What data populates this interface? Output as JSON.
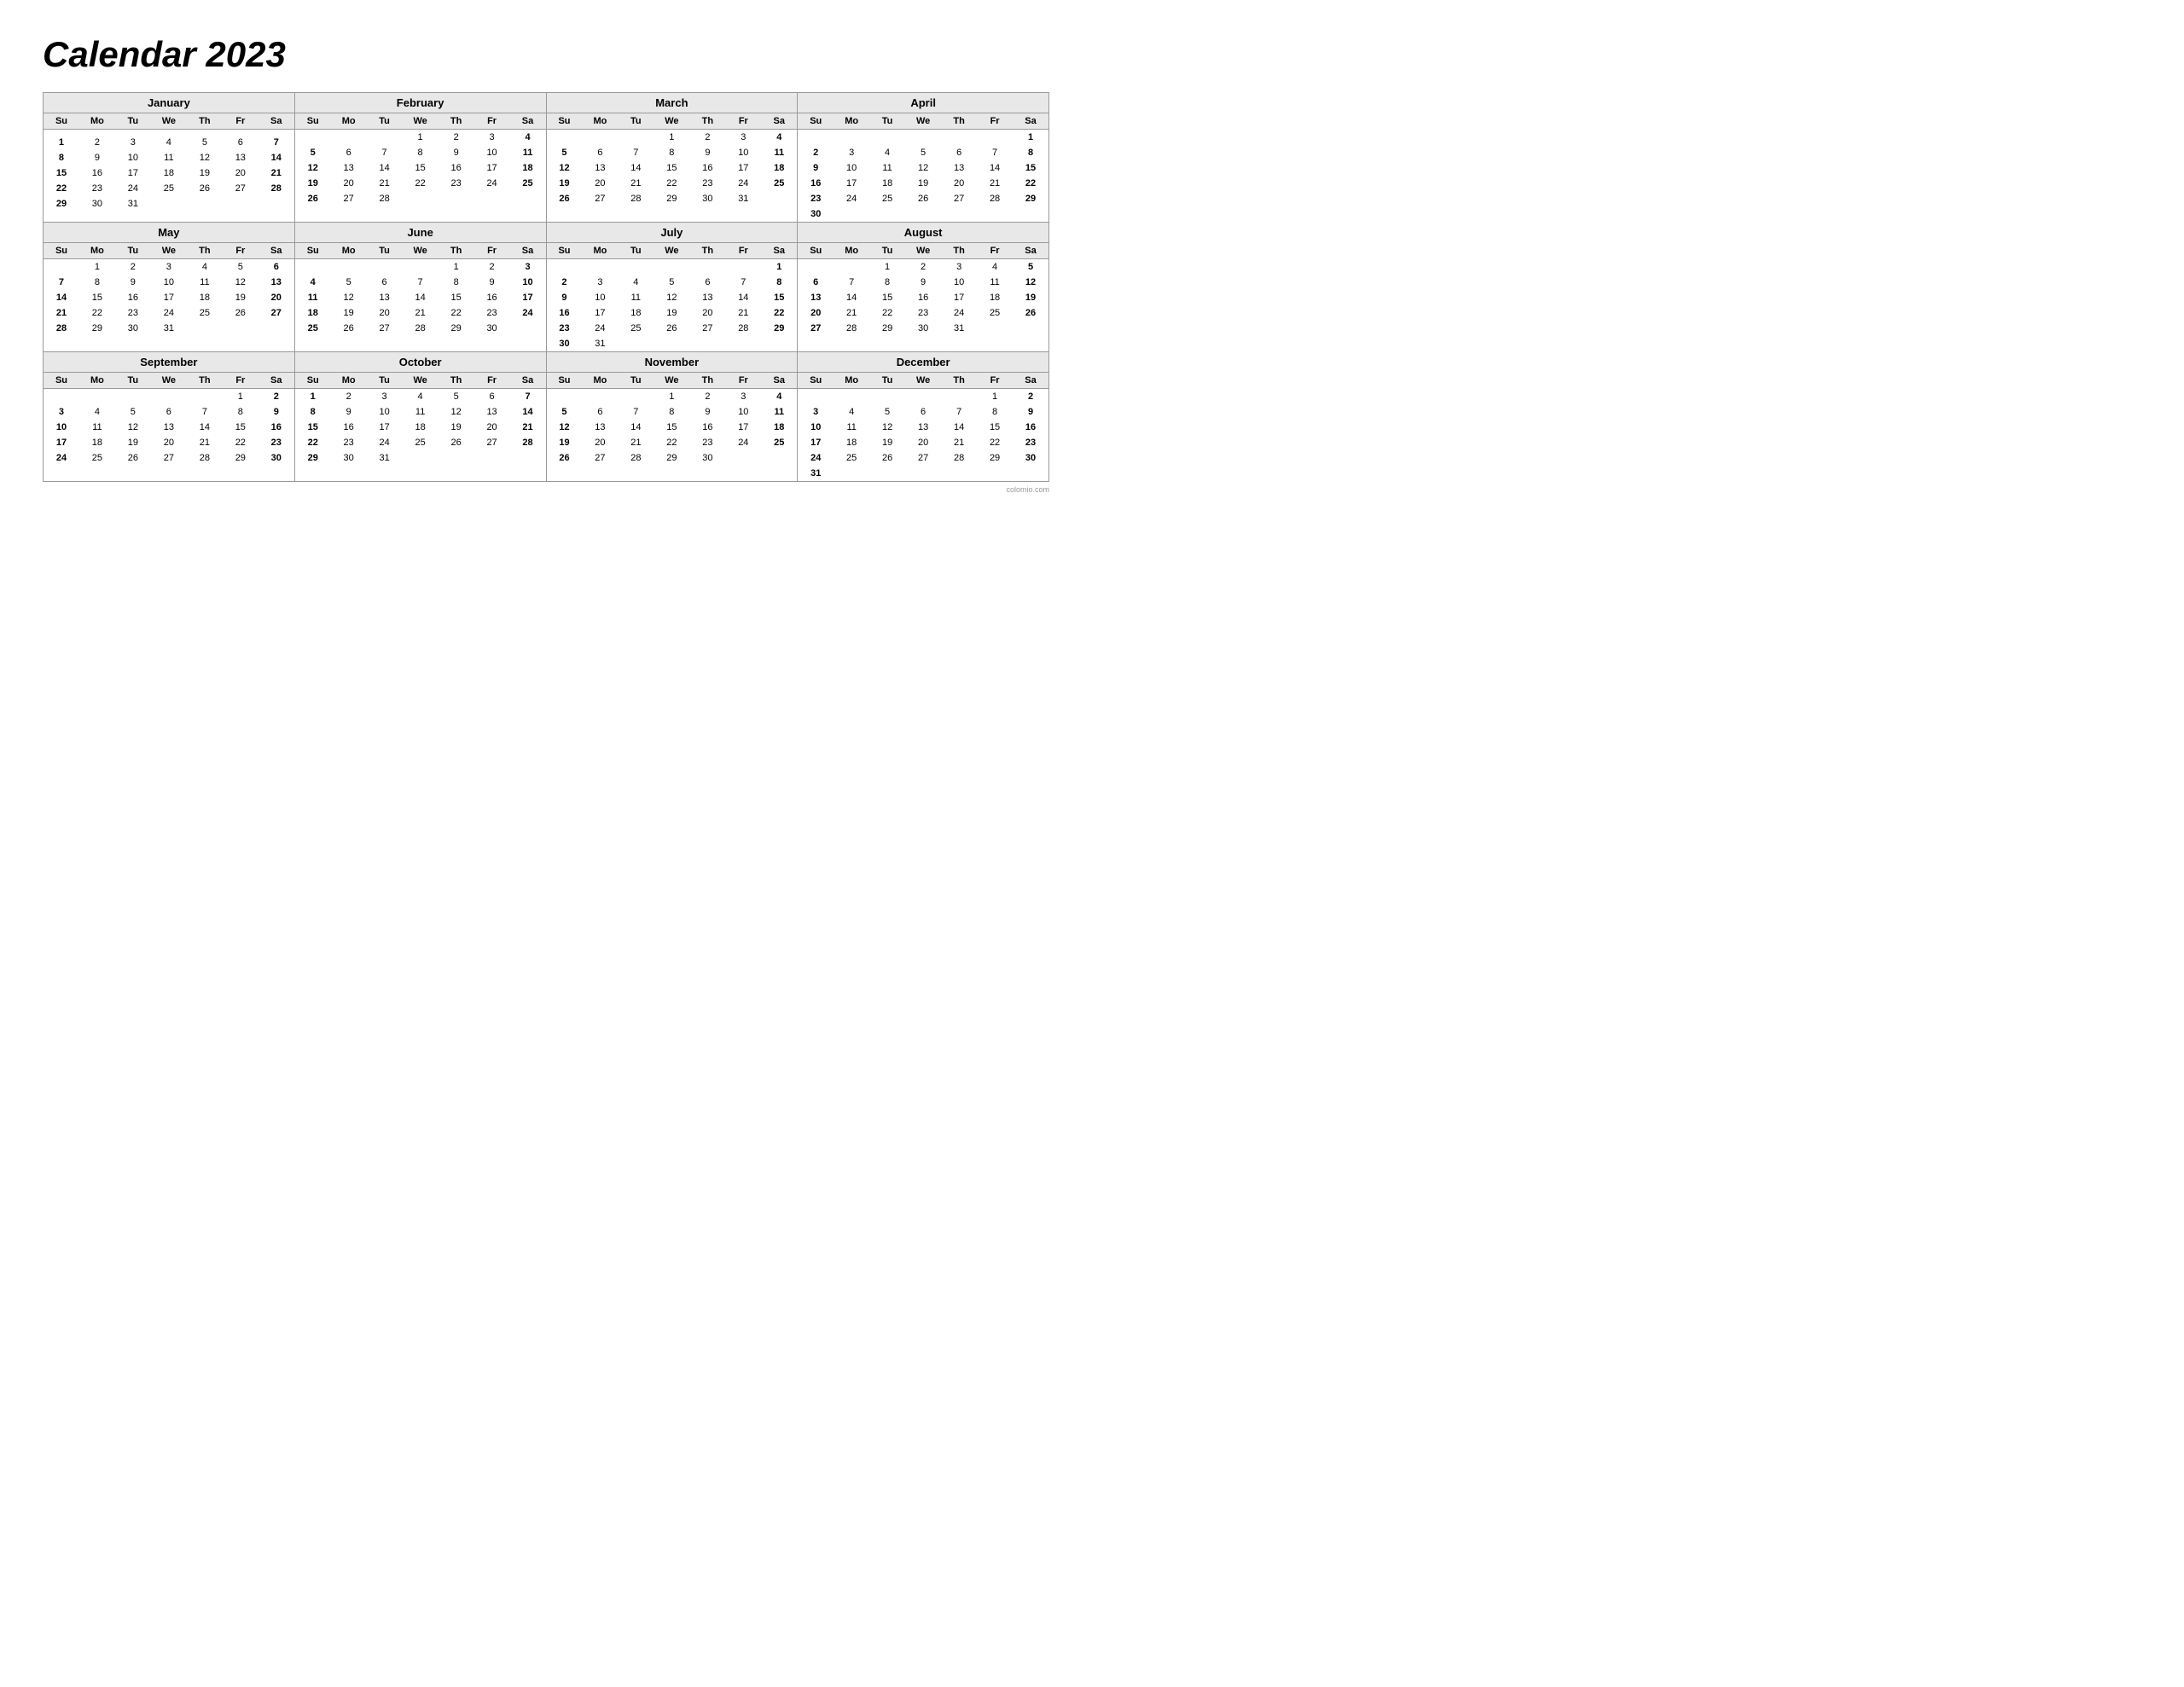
{
  "title": "Calendar 2023",
  "months": [
    {
      "name": "January",
      "days_header": [
        "Su",
        "Mo",
        "Tu",
        "We",
        "Th",
        "Fr",
        "Sa"
      ],
      "weeks": [
        [
          "",
          "",
          "",
          "",
          "",
          "",
          ""
        ],
        [
          "1",
          "2",
          "3",
          "4",
          "5",
          "6",
          "7"
        ],
        [
          "8",
          "9",
          "10",
          "11",
          "12",
          "13",
          "14"
        ],
        [
          "15",
          "16",
          "17",
          "18",
          "19",
          "20",
          "21"
        ],
        [
          "22",
          "23",
          "24",
          "25",
          "26",
          "27",
          "28"
        ],
        [
          "29",
          "30",
          "31",
          "",
          "",
          "",
          ""
        ]
      ]
    },
    {
      "name": "February",
      "days_header": [
        "Su",
        "Mo",
        "Tu",
        "We",
        "Th",
        "Fr",
        "Sa"
      ],
      "weeks": [
        [
          "",
          "",
          "",
          "1",
          "2",
          "3",
          "4"
        ],
        [
          "5",
          "6",
          "7",
          "8",
          "9",
          "10",
          "11"
        ],
        [
          "12",
          "13",
          "14",
          "15",
          "16",
          "17",
          "18"
        ],
        [
          "19",
          "20",
          "21",
          "22",
          "23",
          "24",
          "25"
        ],
        [
          "26",
          "27",
          "28",
          "",
          "",
          "",
          ""
        ],
        [
          "",
          "",
          "",
          "",
          "",
          "",
          ""
        ]
      ]
    },
    {
      "name": "March",
      "days_header": [
        "Su",
        "Mo",
        "Tu",
        "We",
        "Th",
        "Fr",
        "Sa"
      ],
      "weeks": [
        [
          "",
          "",
          "",
          "1",
          "2",
          "3",
          "4"
        ],
        [
          "5",
          "6",
          "7",
          "8",
          "9",
          "10",
          "11"
        ],
        [
          "12",
          "13",
          "14",
          "15",
          "16",
          "17",
          "18"
        ],
        [
          "19",
          "20",
          "21",
          "22",
          "23",
          "24",
          "25"
        ],
        [
          "26",
          "27",
          "28",
          "29",
          "30",
          "31",
          ""
        ],
        [
          "",
          "",
          "",
          "",
          "",
          "",
          ""
        ]
      ]
    },
    {
      "name": "April",
      "days_header": [
        "Su",
        "Mo",
        "Tu",
        "We",
        "Th",
        "Fr",
        "Sa"
      ],
      "weeks": [
        [
          "",
          "",
          "",
          "",
          "",
          "",
          "1"
        ],
        [
          "2",
          "3",
          "4",
          "5",
          "6",
          "7",
          "8"
        ],
        [
          "9",
          "10",
          "11",
          "12",
          "13",
          "14",
          "15"
        ],
        [
          "16",
          "17",
          "18",
          "19",
          "20",
          "21",
          "22"
        ],
        [
          "23",
          "24",
          "25",
          "26",
          "27",
          "28",
          "29"
        ],
        [
          "30",
          "",
          "",
          "",
          "",
          "",
          ""
        ]
      ]
    },
    {
      "name": "May",
      "days_header": [
        "Su",
        "Mo",
        "Tu",
        "We",
        "Th",
        "Fr",
        "Sa"
      ],
      "weeks": [
        [
          "",
          "1",
          "2",
          "3",
          "4",
          "5",
          "6"
        ],
        [
          "7",
          "8",
          "9",
          "10",
          "11",
          "12",
          "13"
        ],
        [
          "14",
          "15",
          "16",
          "17",
          "18",
          "19",
          "20"
        ],
        [
          "21",
          "22",
          "23",
          "24",
          "25",
          "26",
          "27"
        ],
        [
          "28",
          "29",
          "30",
          "31",
          "",
          "",
          ""
        ],
        [
          "",
          "",
          "",
          "",
          "",
          "",
          ""
        ]
      ]
    },
    {
      "name": "June",
      "days_header": [
        "Su",
        "Mo",
        "Tu",
        "We",
        "Th",
        "Fr",
        "Sa"
      ],
      "weeks": [
        [
          "",
          "",
          "",
          "",
          "1",
          "2",
          "3"
        ],
        [
          "4",
          "5",
          "6",
          "7",
          "8",
          "9",
          "10"
        ],
        [
          "11",
          "12",
          "13",
          "14",
          "15",
          "16",
          "17"
        ],
        [
          "18",
          "19",
          "20",
          "21",
          "22",
          "23",
          "24"
        ],
        [
          "25",
          "26",
          "27",
          "28",
          "29",
          "30",
          ""
        ],
        [
          "",
          "",
          "",
          "",
          "",
          "",
          ""
        ]
      ]
    },
    {
      "name": "July",
      "days_header": [
        "Su",
        "Mo",
        "Tu",
        "We",
        "Th",
        "Fr",
        "Sa"
      ],
      "weeks": [
        [
          "",
          "",
          "",
          "",
          "",
          "",
          "1"
        ],
        [
          "2",
          "3",
          "4",
          "5",
          "6",
          "7",
          "8"
        ],
        [
          "9",
          "10",
          "11",
          "12",
          "13",
          "14",
          "15"
        ],
        [
          "16",
          "17",
          "18",
          "19",
          "20",
          "21",
          "22"
        ],
        [
          "23",
          "24",
          "25",
          "26",
          "27",
          "28",
          "29"
        ],
        [
          "30",
          "31",
          "",
          "",
          "",
          "",
          ""
        ]
      ]
    },
    {
      "name": "August",
      "days_header": [
        "Su",
        "Mo",
        "Tu",
        "We",
        "Th",
        "Fr",
        "Sa"
      ],
      "weeks": [
        [
          "",
          "",
          "1",
          "2",
          "3",
          "4",
          "5"
        ],
        [
          "6",
          "7",
          "8",
          "9",
          "10",
          "11",
          "12"
        ],
        [
          "13",
          "14",
          "15",
          "16",
          "17",
          "18",
          "19"
        ],
        [
          "20",
          "21",
          "22",
          "23",
          "24",
          "25",
          "26"
        ],
        [
          "27",
          "28",
          "29",
          "30",
          "31",
          "",
          ""
        ],
        [
          "",
          "",
          "",
          "",
          "",
          "",
          ""
        ]
      ]
    },
    {
      "name": "September",
      "days_header": [
        "Su",
        "Mo",
        "Tu",
        "We",
        "Th",
        "Fr",
        "Sa"
      ],
      "weeks": [
        [
          "",
          "",
          "",
          "",
          "",
          "1",
          "2"
        ],
        [
          "3",
          "4",
          "5",
          "6",
          "7",
          "8",
          "9"
        ],
        [
          "10",
          "11",
          "12",
          "13",
          "14",
          "15",
          "16"
        ],
        [
          "17",
          "18",
          "19",
          "20",
          "21",
          "22",
          "23"
        ],
        [
          "24",
          "25",
          "26",
          "27",
          "28",
          "29",
          "30"
        ],
        [
          "",
          "",
          "",
          "",
          "",
          "",
          ""
        ]
      ]
    },
    {
      "name": "October",
      "days_header": [
        "Su",
        "Mo",
        "Tu",
        "We",
        "Th",
        "Fr",
        "Sa"
      ],
      "weeks": [
        [
          "1",
          "2",
          "3",
          "4",
          "5",
          "6",
          "7"
        ],
        [
          "8",
          "9",
          "10",
          "11",
          "12",
          "13",
          "14"
        ],
        [
          "15",
          "16",
          "17",
          "18",
          "19",
          "20",
          "21"
        ],
        [
          "22",
          "23",
          "24",
          "25",
          "26",
          "27",
          "28"
        ],
        [
          "29",
          "30",
          "31",
          "",
          "",
          "",
          ""
        ],
        [
          "",
          "",
          "",
          "",
          "",
          "",
          ""
        ]
      ]
    },
    {
      "name": "November",
      "days_header": [
        "Su",
        "Mo",
        "Tu",
        "We",
        "Th",
        "Fr",
        "Sa"
      ],
      "weeks": [
        [
          "",
          "",
          "",
          "1",
          "2",
          "3",
          "4"
        ],
        [
          "5",
          "6",
          "7",
          "8",
          "9",
          "10",
          "11"
        ],
        [
          "12",
          "13",
          "14",
          "15",
          "16",
          "17",
          "18"
        ],
        [
          "19",
          "20",
          "21",
          "22",
          "23",
          "24",
          "25"
        ],
        [
          "26",
          "27",
          "28",
          "29",
          "30",
          "",
          ""
        ],
        [
          "",
          "",
          "",
          "",
          "",
          "",
          ""
        ]
      ]
    },
    {
      "name": "December",
      "days_header": [
        "Su",
        "Mo",
        "Tu",
        "We",
        "Th",
        "Fr",
        "Sa"
      ],
      "weeks": [
        [
          "",
          "",
          "",
          "",
          "",
          "1",
          "2"
        ],
        [
          "3",
          "4",
          "5",
          "6",
          "7",
          "8",
          "9"
        ],
        [
          "10",
          "11",
          "12",
          "13",
          "14",
          "15",
          "16"
        ],
        [
          "17",
          "18",
          "19",
          "20",
          "21",
          "22",
          "23"
        ],
        [
          "24",
          "25",
          "26",
          "27",
          "28",
          "29",
          "30"
        ],
        [
          "31",
          "",
          "",
          "",
          "",
          "",
          ""
        ]
      ]
    }
  ],
  "watermark": "colomio.com"
}
